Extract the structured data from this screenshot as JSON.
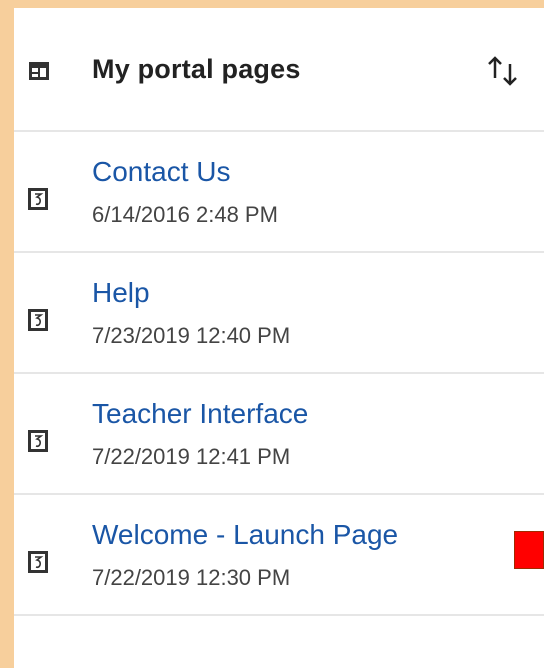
{
  "header": {
    "title": "My portal pages",
    "icon": "portal-pages-icon",
    "sort_icon": "sort-arrows-icon"
  },
  "pages": [
    {
      "title": "Contact Us",
      "date": "6/14/2016 2:48 PM",
      "icon": "portal-page-icon"
    },
    {
      "title": "Help",
      "date": "7/23/2019 12:40 PM",
      "icon": "portal-page-icon"
    },
    {
      "title": "Teacher Interface",
      "date": "7/22/2019 12:41 PM",
      "icon": "portal-page-icon"
    },
    {
      "title": "Welcome - Launch Page",
      "date": "7/22/2019 12:30 PM",
      "icon": "portal-page-icon"
    }
  ],
  "colors": {
    "background": "#f7cf9c",
    "link": "#1a56a6",
    "marker": "#ff0000"
  }
}
